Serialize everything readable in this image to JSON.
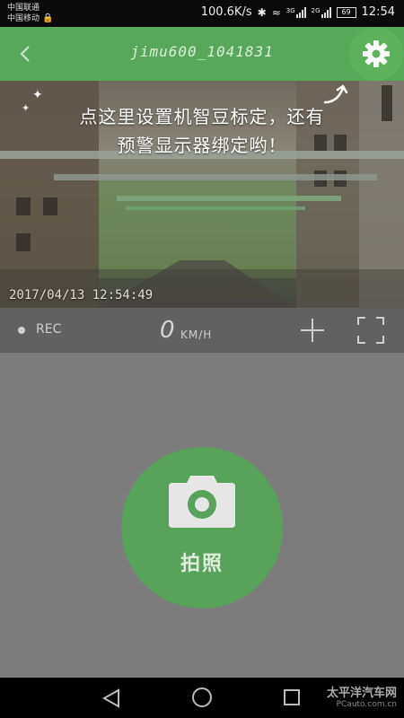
{
  "status_bar": {
    "carrier_1": "中国联通",
    "carrier_2": "中国移动",
    "net_speed": "100.6K/s",
    "net_type_1": "3G",
    "net_type_2": "2G",
    "battery": "69",
    "time": "12:54"
  },
  "header": {
    "back_icon": "chevron-left-icon",
    "title": "jimu600_1041831",
    "settings_icon": "gear-icon"
  },
  "video": {
    "tip_line_1": "点这里设置机智豆标定，还有",
    "tip_line_2": "预警显示器绑定哟！",
    "timestamp": "2017/04/13 12:54:49"
  },
  "controls": {
    "rec_label": "REC",
    "speed_value": "0",
    "speed_unit": "KM/H",
    "plus_icon": "plus-icon",
    "fullscreen_icon": "fullscreen-icon"
  },
  "main": {
    "photo_label": "拍照",
    "camera_icon": "camera-icon"
  },
  "nav": {
    "back_icon": "triangle-back-icon",
    "home_icon": "circle-home-icon",
    "recent_icon": "square-recent-icon"
  },
  "watermark": {
    "main": "太平洋汽车网",
    "sub": "PCauto.com.cn"
  },
  "colors": {
    "header_green": "#58a85a",
    "photo_button_green": "#56a359",
    "control_bar": "#616161",
    "main_bg": "#7c7c7c"
  }
}
